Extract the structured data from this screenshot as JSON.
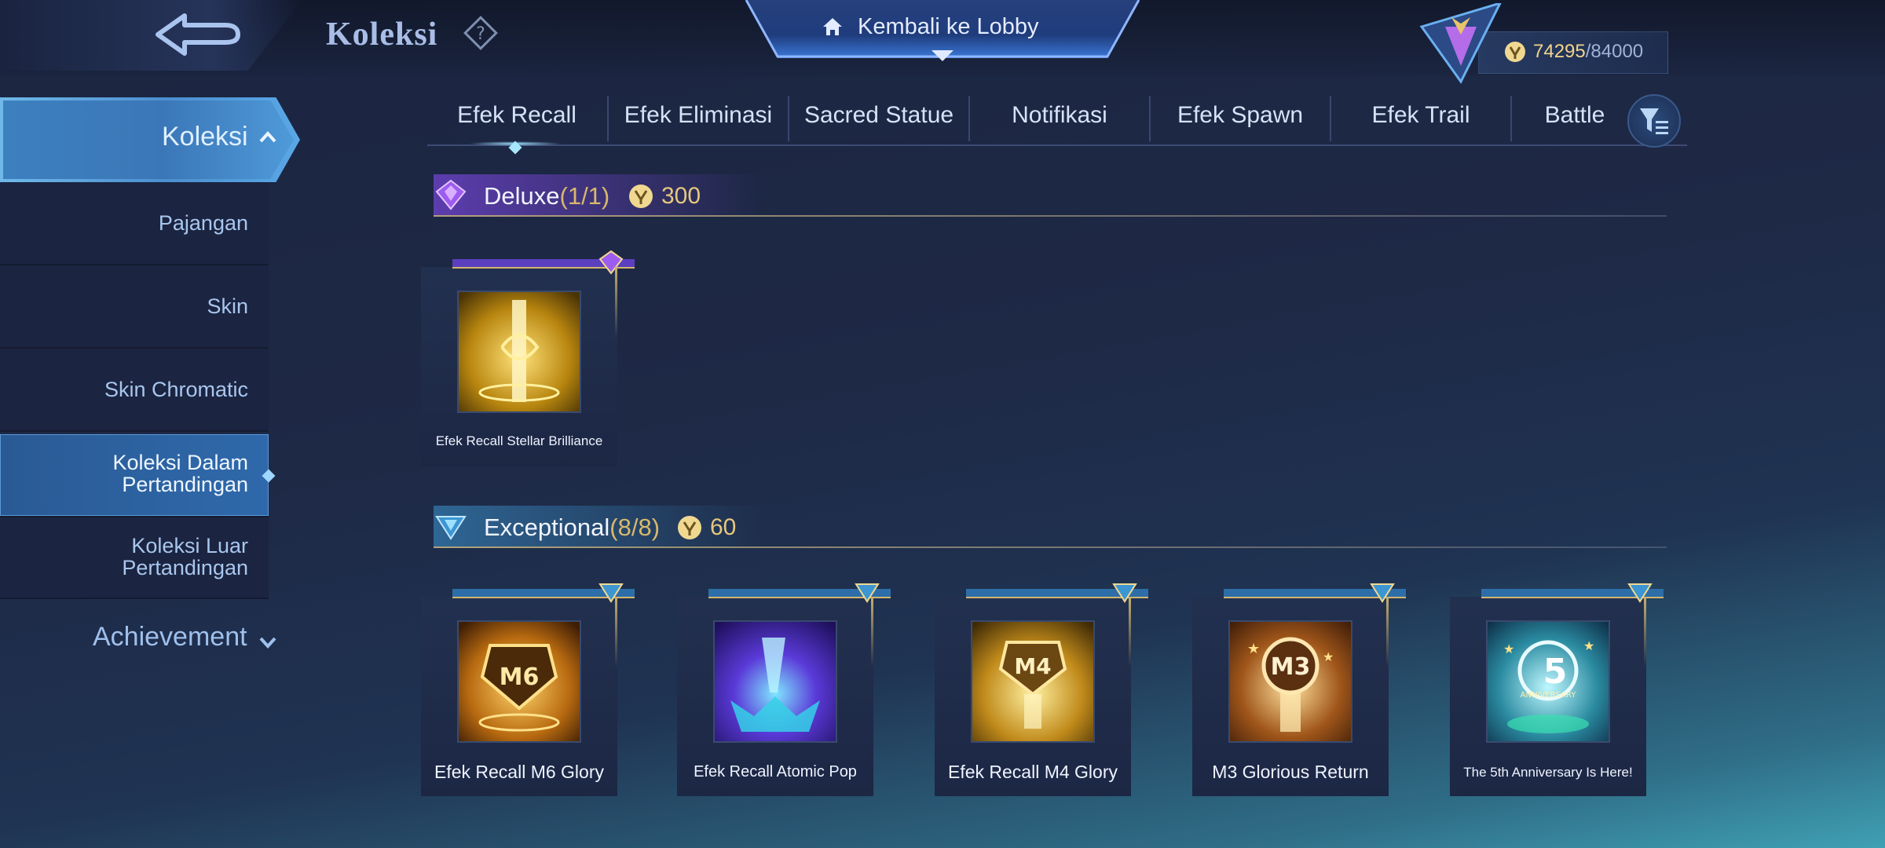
{
  "header": {
    "title": "Koleksi",
    "lobby_label": "Kembali ke Lobby",
    "currency_value": "74295",
    "currency_max": "/84000"
  },
  "sidebar": {
    "main_label": "Koleksi",
    "items": [
      {
        "label": "Pajangan"
      },
      {
        "label": "Skin"
      },
      {
        "label": "Skin Chromatic"
      },
      {
        "label": "Koleksi Dalam Pertandingan"
      },
      {
        "label": "Koleksi Luar Pertandingan"
      }
    ],
    "achievement_label": "Achievement"
  },
  "tabs": [
    {
      "label": "Efek Recall"
    },
    {
      "label": "Efek Eliminasi"
    },
    {
      "label": "Sacred Statue"
    },
    {
      "label": "Notifikasi"
    },
    {
      "label": "Efek Spawn"
    },
    {
      "label": "Efek Trail"
    },
    {
      "label": "Battle"
    }
  ],
  "sections": {
    "deluxe": {
      "title": "Deluxe",
      "count": "(1/1)",
      "cost": "300",
      "items": [
        {
          "name": "Efek Recall Stellar Brilliance"
        }
      ]
    },
    "exceptional": {
      "title": "Exceptional",
      "count": "(8/8)",
      "cost": "60",
      "items": [
        {
          "name": "Efek Recall M6 Glory"
        },
        {
          "name": "Efek Recall Atomic Pop"
        },
        {
          "name": "Efek Recall M4 Glory"
        },
        {
          "name": "M3 Glorious Return"
        },
        {
          "name": "The 5th Anniversary Is Here!"
        }
      ]
    }
  },
  "thumb_text": {
    "m6": "M6",
    "m4": "M4",
    "m3": "M3",
    "five": "5",
    "anniv": "ANNIVERSARY"
  },
  "colors": {
    "accent_gold": "#e6c77e",
    "active_blue": "#4b8fd0",
    "deluxe_purple": "#7a46dc",
    "exceptional_teal": "#3c96d2"
  },
  "icons": [
    "back-arrow-icon",
    "help-icon",
    "home-icon",
    "rank-emblem-icon",
    "battle-point-icon",
    "filter-icon",
    "chevron-up-icon",
    "chevron-down-icon",
    "deluxe-gem-icon",
    "exceptional-gem-icon"
  ]
}
